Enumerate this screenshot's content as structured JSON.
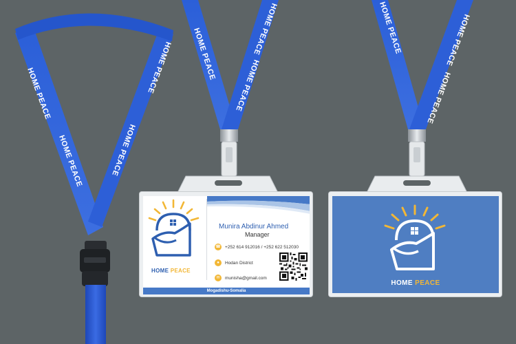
{
  "colors": {
    "background": "#5d6466",
    "lanyard_blue": "#2f63d6",
    "brand_blue": "#2e5fb0",
    "brand_yellow": "#f2b736",
    "back_card_blue": "#4f7ec2"
  },
  "lanyard": {
    "print_text": "HOME PEACE"
  },
  "front_card": {
    "brand_primary": "HOME",
    "brand_accent": "PEACE",
    "name": "Munira Abdinur Ahmed",
    "title": "Manager",
    "phone_icon": "phone-icon",
    "phone": "+252 614 912016  /  +252 622 512030",
    "location_icon": "location-pin-icon",
    "location": "Hodan District",
    "email_icon": "email-icon",
    "email": "munisha@gmail.com",
    "footer": "Mogadishu-Somalia"
  },
  "back_card": {
    "brand_primary": "HOME",
    "brand_accent": "PEACE"
  }
}
